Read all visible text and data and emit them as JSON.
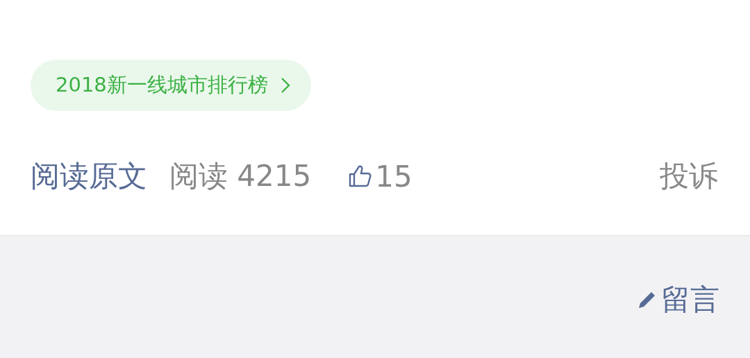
{
  "topic_tag": {
    "label": "2018新一线城市排行榜"
  },
  "footer": {
    "read_original": "阅读原文",
    "read_count": "阅读 4215",
    "likes": "15",
    "report": "投诉"
  },
  "comment": {
    "label": "留言"
  }
}
